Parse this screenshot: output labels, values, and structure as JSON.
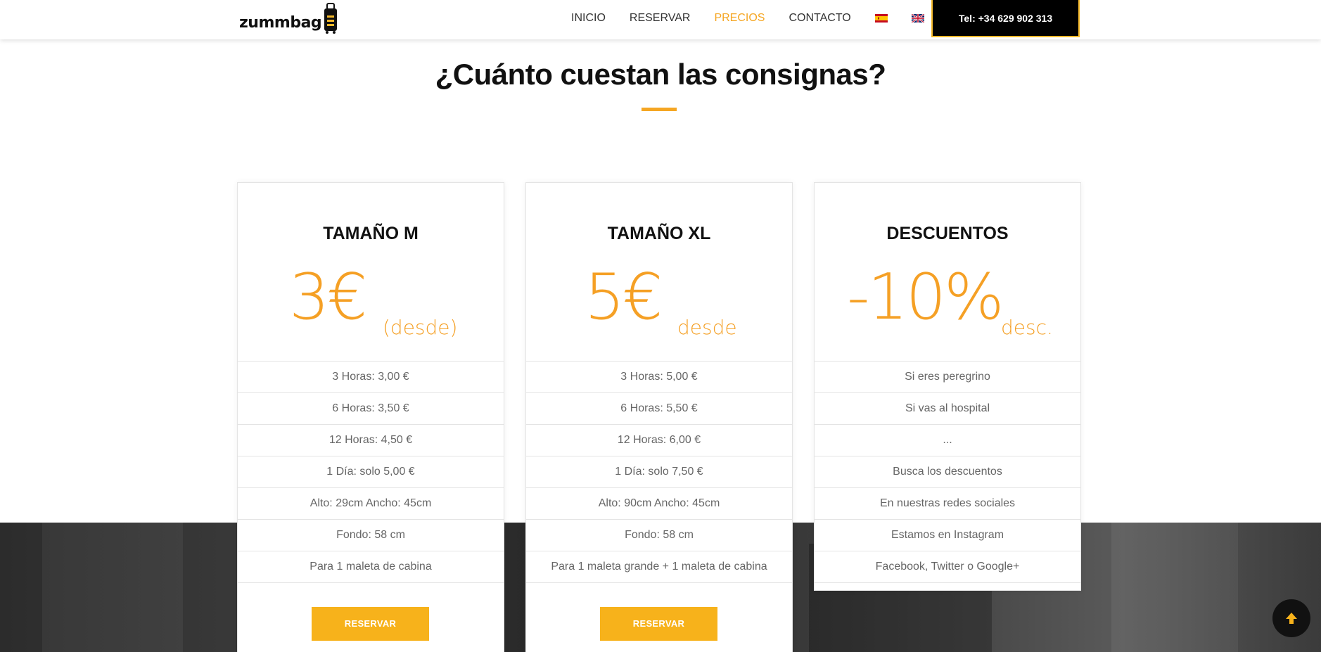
{
  "header": {
    "logo_text": "zummbag",
    "nav": [
      {
        "label": "INICIO",
        "active": false
      },
      {
        "label": "RESERVAR",
        "active": false
      },
      {
        "label": "PRECIOS",
        "active": true
      },
      {
        "label": "CONTACTO",
        "active": false
      }
    ],
    "languages": [
      "es-flag-icon",
      "uk-flag-icon"
    ],
    "phone_label": "Tel: +34 629 902 313"
  },
  "section": {
    "title": "¿Cuánto cuestan las consignas?"
  },
  "cards": [
    {
      "title": "TAMAÑO M",
      "price": "3€",
      "price_suffix": "(desde)",
      "rows": [
        "3 Horas: 3,00 €",
        "6 Horas: 3,50 €",
        "12 Horas: 4,50 €",
        "1 Día: solo 5,00 €",
        "Alto: 29cm Ancho: 45cm",
        "Fondo: 58 cm",
        "Para 1 maleta de cabina"
      ],
      "button": "RESERVAR"
    },
    {
      "title": "TAMAÑO XL",
      "price": "5€",
      "price_suffix": "desde",
      "rows": [
        "3 Horas: 5,00 €",
        "6 Horas: 5,50 €",
        "12 Horas: 6,00 €",
        "1 Día: solo 7,50 €",
        "Alto: 90cm Ancho: 45cm",
        "Fondo: 58 cm",
        "Para 1 maleta grande + 1 maleta de cabina"
      ],
      "button": "RESERVAR"
    },
    {
      "title": "DESCUENTOS",
      "price": "-10%",
      "price_suffix": "desc.",
      "rows": [
        "Si eres peregrino",
        "Si vas al hospital",
        "...",
        "Busca los descuentos",
        "En nuestras redes sociales",
        "Estamos en Instagram",
        "Facebook, Twitter o Google+"
      ]
    }
  ],
  "colors": {
    "accent": "#f5a623",
    "button": "#f7b21b",
    "dark": "#000000"
  },
  "scroll_top_icon": "arrow-up-icon"
}
